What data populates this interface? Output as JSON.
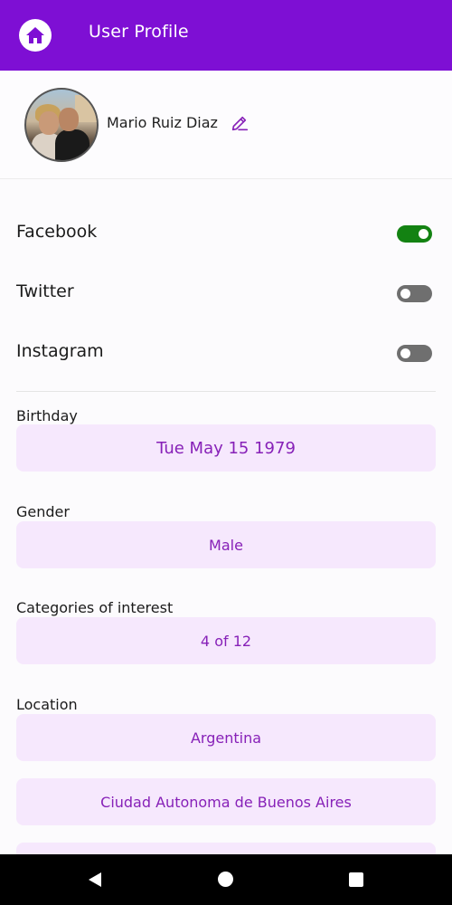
{
  "appbar": {
    "title": "User Profile",
    "icon": "home-icon"
  },
  "profile": {
    "name": "Mario Ruiz Diaz",
    "edit_icon": "pencil-icon"
  },
  "social": [
    {
      "label": "Facebook",
      "enabled": true
    },
    {
      "label": "Twitter",
      "enabled": false
    },
    {
      "label": "Instagram",
      "enabled": false
    }
  ],
  "fields": {
    "birthday": {
      "label": "Birthday",
      "value": "Tue May 15 1979"
    },
    "gender": {
      "label": "Gender",
      "value": "Male"
    },
    "categories": {
      "label": "Categories of interest",
      "value": "4 of 12"
    },
    "location": {
      "label": "Location",
      "country": "Argentina",
      "region": "Ciudad Autonoma de Buenos Aires"
    }
  },
  "colors": {
    "primary": "#7e0fd4",
    "accent_text": "#8721b8",
    "field_bg": "#f6e8fd",
    "toggle_on": "#138212",
    "toggle_off": "#6f6f6f"
  },
  "system_nav": {
    "back": "back-icon",
    "home": "home-circle-icon",
    "recents": "recents-icon"
  }
}
